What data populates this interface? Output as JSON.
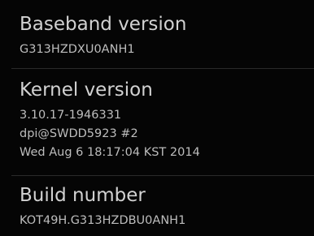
{
  "colors": {
    "background": "#050505",
    "title_text": "#d2d2d2",
    "summary_text": "#bdbdbd",
    "divider": "#2a2a2a"
  },
  "items": [
    {
      "title": "Baseband version",
      "lines": [
        "G313HZDXU0ANH1"
      ]
    },
    {
      "title": "Kernel version",
      "lines": [
        "3.10.17-1946331",
        "dpi@SWDD5923 #2",
        "Wed Aug 6 18:17:04 KST 2014"
      ]
    },
    {
      "title": "Build number",
      "lines": [
        "KOT49H.G313HZDBU0ANH1"
      ]
    }
  ]
}
